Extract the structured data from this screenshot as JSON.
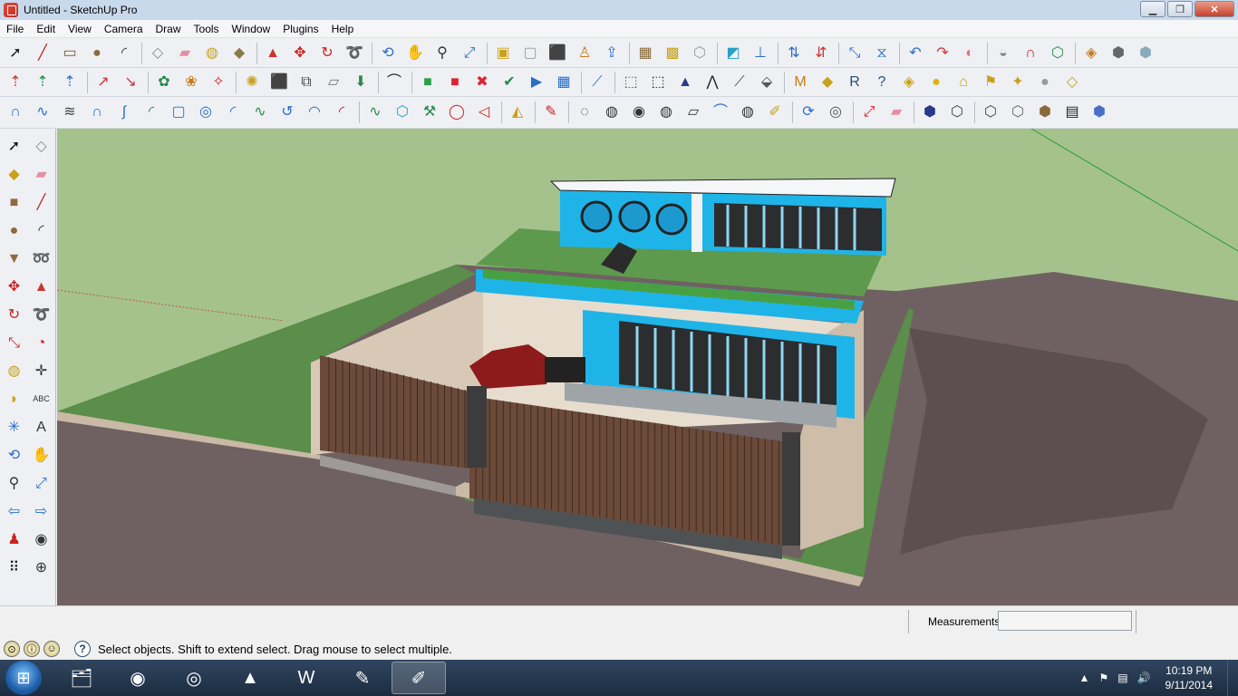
{
  "window": {
    "title": "Untitled - SketchUp Pro"
  },
  "menu": [
    "File",
    "Edit",
    "View",
    "Camera",
    "Draw",
    "Tools",
    "Window",
    "Plugins",
    "Help"
  ],
  "toolbars": {
    "row1": [
      {
        "name": "select-icon",
        "glyph": "➚",
        "color": "#222"
      },
      {
        "name": "line-icon",
        "glyph": "╱",
        "color": "#b22"
      },
      {
        "name": "rectangle-icon",
        "glyph": "▭",
        "color": "#7a5a30"
      },
      {
        "name": "circle-icon",
        "glyph": "●",
        "color": "#8d6a3f"
      },
      {
        "name": "arc-icon",
        "glyph": "◜",
        "color": "#333"
      },
      {
        "name": "sep"
      },
      {
        "name": "make-component-icon",
        "glyph": "◇",
        "color": "#888"
      },
      {
        "name": "eraser-icon",
        "glyph": "▰",
        "color": "#e58fa6"
      },
      {
        "name": "tape-measure-icon",
        "glyph": "◍",
        "color": "#c9a11a"
      },
      {
        "name": "paint-bucket-icon",
        "glyph": "◆",
        "color": "#8a7a4a"
      },
      {
        "name": "sep"
      },
      {
        "name": "push-pull-icon",
        "glyph": "▲",
        "color": "#c33"
      },
      {
        "name": "move-icon",
        "glyph": "✥",
        "color": "#c22"
      },
      {
        "name": "rotate-icon",
        "glyph": "↻",
        "color": "#c22"
      },
      {
        "name": "follow-me-icon",
        "glyph": "➰",
        "color": "#c22"
      },
      {
        "name": "sep"
      },
      {
        "name": "orbit-icon",
        "glyph": "⟲",
        "color": "#2a6ec7"
      },
      {
        "name": "pan-icon",
        "glyph": "✋",
        "color": "#555"
      },
      {
        "name": "zoom-icon",
        "glyph": "⚲",
        "color": "#333"
      },
      {
        "name": "zoom-extents-icon",
        "glyph": "⤢",
        "color": "#2a6ec7"
      },
      {
        "name": "sep"
      },
      {
        "name": "previous-view-icon",
        "glyph": "▣",
        "color": "#c9a11a"
      },
      {
        "name": "next-view-icon",
        "glyph": "▢",
        "color": "#999"
      },
      {
        "name": "get-models-icon",
        "glyph": "⬛",
        "color": "#8c4a2f"
      },
      {
        "name": "share-model-icon",
        "glyph": "♙",
        "color": "#c77a1a"
      },
      {
        "name": "upload-icon",
        "glyph": "⇪",
        "color": "#2a6ec7"
      },
      {
        "name": "sep"
      },
      {
        "name": "iso-view-icon",
        "glyph": "▦",
        "color": "#8a6a3a"
      },
      {
        "name": "top-view-icon",
        "glyph": "▩",
        "color": "#c9a11a"
      },
      {
        "name": "front-view-icon",
        "glyph": "⬡",
        "color": "#999"
      },
      {
        "name": "sep"
      },
      {
        "name": "section-plane-icon",
        "glyph": "◩",
        "color": "#2aa0c7"
      },
      {
        "name": "axes-icon",
        "glyph": "⊥",
        "color": "#2a6ec7"
      },
      {
        "name": "sep"
      },
      {
        "name": "dimension-icon",
        "glyph": "⇅",
        "color": "#2a6ec7"
      },
      {
        "name": "text-arrows-icon",
        "glyph": "⇵",
        "color": "#c33"
      },
      {
        "name": "sep"
      },
      {
        "name": "scale-icon",
        "glyph": "⤡",
        "color": "#2a6ec7"
      },
      {
        "name": "flip-icon",
        "glyph": "⧖",
        "color": "#2a6ec7"
      },
      {
        "name": "sep"
      },
      {
        "name": "undo-icon",
        "glyph": "↶",
        "color": "#2a6ec7"
      },
      {
        "name": "redo-icon",
        "glyph": "↷",
        "color": "#c33"
      },
      {
        "name": "sandbox-icon",
        "glyph": "◐",
        "color": "#d77"
      },
      {
        "name": "sep"
      },
      {
        "name": "shell-icon",
        "glyph": "◒",
        "color": "#888"
      },
      {
        "name": "magnet-icon",
        "glyph": "∩",
        "color": "#c22"
      },
      {
        "name": "component-options-icon",
        "glyph": "⬡",
        "color": "#2a8a4a"
      },
      {
        "name": "sep"
      },
      {
        "name": "warehouse-icon",
        "glyph": "◈",
        "color": "#c77a1a"
      },
      {
        "name": "wireframe-box-icon",
        "glyph": "⬢",
        "color": "#666"
      },
      {
        "name": "solid-box-icon",
        "glyph": "⬢",
        "color": "#8ab"
      }
    ],
    "row2": [
      {
        "name": "axis-j-icon",
        "glyph": "⇡",
        "color": "#c33"
      },
      {
        "name": "axis-v-icon",
        "glyph": "⇡",
        "color": "#2a8a4a"
      },
      {
        "name": "axis-n-icon",
        "glyph": "⇡",
        "color": "#2a6ec7"
      },
      {
        "name": "sep"
      },
      {
        "name": "arrow-up-icon",
        "glyph": "↗",
        "color": "#c33"
      },
      {
        "name": "arrow-right-icon",
        "glyph": "↘",
        "color": "#c33"
      },
      {
        "name": "sep"
      },
      {
        "name": "vegetation-icon",
        "glyph": "✿",
        "color": "#2a8a4a"
      },
      {
        "name": "palm-icon",
        "glyph": "❀",
        "color": "#c77a1a"
      },
      {
        "name": "spp-icon",
        "glyph": "✧",
        "color": "#c22"
      },
      {
        "name": "sep"
      },
      {
        "name": "bee-icon",
        "glyph": "✺",
        "color": "#c9a11a"
      },
      {
        "name": "cube-icon",
        "glyph": "⬛",
        "color": "#555"
      },
      {
        "name": "shapes-icon",
        "glyph": "⧉",
        "color": "#444"
      },
      {
        "name": "eraser-small-icon",
        "glyph": "▱",
        "color": "#777"
      },
      {
        "name": "svg-import-icon",
        "glyph": "⬇",
        "color": "#2a8a4a"
      },
      {
        "name": "sep"
      },
      {
        "name": "arc-tool-icon",
        "glyph": "⌒",
        "color": "#222"
      },
      {
        "name": "sep"
      },
      {
        "name": "film-green-icon",
        "glyph": "■",
        "color": "#2aa04a"
      },
      {
        "name": "film-red-icon",
        "glyph": "■",
        "color": "#d23"
      },
      {
        "name": "film-x-icon",
        "glyph": "✖",
        "color": "#d23"
      },
      {
        "name": "film-check-icon",
        "glyph": "✔",
        "color": "#2a8a4a"
      },
      {
        "name": "film-play-icon",
        "glyph": "▶",
        "color": "#2a6ec7"
      },
      {
        "name": "film-grid-icon",
        "glyph": "▦",
        "color": "#2a6ec7"
      },
      {
        "name": "sep"
      },
      {
        "name": "ruler-icon",
        "glyph": "⟋",
        "color": "#2a6ec7"
      },
      {
        "name": "sep"
      },
      {
        "name": "box-icon",
        "glyph": "⬚",
        "color": "#555"
      },
      {
        "name": "mesh-box-icon",
        "glyph": "⬚",
        "color": "#222"
      },
      {
        "name": "triangle-icon",
        "glyph": "▲",
        "color": "#2a3a8a"
      },
      {
        "name": "peak-icon",
        "glyph": "⋀",
        "color": "#222"
      },
      {
        "name": "pin-icon",
        "glyph": "⟋",
        "color": "#444"
      },
      {
        "name": "terrain-icon",
        "glyph": "⬙",
        "color": "#555"
      },
      {
        "name": "sep"
      },
      {
        "name": "m-badge-icon",
        "glyph": "M",
        "color": "#c77a1a"
      },
      {
        "name": "tag-icon",
        "glyph": "◆",
        "color": "#c9a11a"
      },
      {
        "name": "r-badge-icon",
        "glyph": "R",
        "color": "#2a4f7c"
      },
      {
        "name": "help-icon",
        "glyph": "?",
        "color": "#2a4f7c"
      },
      {
        "name": "label-icon",
        "glyph": "◈",
        "color": "#c9a11a"
      },
      {
        "name": "sun-icon",
        "glyph": "●",
        "color": "#e0b010"
      },
      {
        "name": "lamp-icon",
        "glyph": "⌂",
        "color": "#c9a11a"
      },
      {
        "name": "flag-icon",
        "glyph": "⚑",
        "color": "#c9a11a"
      },
      {
        "name": "spotlight-icon",
        "glyph": "✦",
        "color": "#c9a11a"
      },
      {
        "name": "sphere-icon",
        "glyph": "●",
        "color": "#999"
      },
      {
        "name": "plane-icon",
        "glyph": "◇",
        "color": "#c9a11a"
      }
    ],
    "row3": [
      {
        "name": "curve-1-icon",
        "glyph": "∩",
        "color": "#2a6ec7"
      },
      {
        "name": "curve-2-icon",
        "glyph": "∿",
        "color": "#2a6ec7"
      },
      {
        "name": "curve-3-icon",
        "glyph": "≋",
        "color": "#444"
      },
      {
        "name": "curve-4-icon",
        "glyph": "∩",
        "color": "#2a6ec7"
      },
      {
        "name": "curve-5-icon",
        "glyph": "∫",
        "color": "#2a6ec7"
      },
      {
        "name": "curve-6-icon",
        "glyph": "◜",
        "color": "#2a8a4a"
      },
      {
        "name": "curve-7-icon",
        "glyph": "▢",
        "color": "#2a6ec7"
      },
      {
        "name": "curve-8-icon",
        "glyph": "◎",
        "color": "#2a6ec7"
      },
      {
        "name": "curve-9-icon",
        "glyph": "◜",
        "color": "#2a6ec7"
      },
      {
        "name": "curve-10-icon",
        "glyph": "∿",
        "color": "#2a8a4a"
      },
      {
        "name": "curve-11-icon",
        "glyph": "↺",
        "color": "#2a6ec7"
      },
      {
        "name": "curve-12-icon",
        "glyph": "◠",
        "color": "#2a6ec7"
      },
      {
        "name": "curve-13-icon",
        "glyph": "◜",
        "color": "#c22"
      },
      {
        "name": "sep"
      },
      {
        "name": "curve-14-icon",
        "glyph": "∿",
        "color": "#2a8a4a"
      },
      {
        "name": "polygon-icon",
        "glyph": "⬡",
        "color": "#2aa0c7"
      },
      {
        "name": "wrench-icon",
        "glyph": "⚒",
        "color": "#2a8a4a"
      },
      {
        "name": "ellipse-icon",
        "glyph": "◯",
        "color": "#c22"
      },
      {
        "name": "spline-icon",
        "glyph": "◁",
        "color": "#c22"
      },
      {
        "name": "sep"
      },
      {
        "name": "surface-icon",
        "glyph": "◭",
        "color": "#c9a11a"
      },
      {
        "name": "sep"
      },
      {
        "name": "pencil-icon",
        "glyph": "✎",
        "color": "#c22"
      },
      {
        "name": "sep"
      },
      {
        "name": "loft-1-icon",
        "glyph": "◌",
        "color": "#333"
      },
      {
        "name": "loft-2-icon",
        "glyph": "◍",
        "color": "#333"
      },
      {
        "name": "loft-3-icon",
        "glyph": "◉",
        "color": "#333"
      },
      {
        "name": "loft-4-icon",
        "glyph": "◍",
        "color": "#333"
      },
      {
        "name": "loft-5-icon",
        "glyph": "▱",
        "color": "#333"
      },
      {
        "name": "loft-6-icon",
        "glyph": "⌒",
        "color": "#2a6ec7"
      },
      {
        "name": "loft-7-icon",
        "glyph": "◍",
        "color": "#333"
      },
      {
        "name": "loft-8-icon",
        "glyph": "✐",
        "color": "#c9a11a"
      },
      {
        "name": "sep"
      },
      {
        "name": "loop-icon",
        "glyph": "⟳",
        "color": "#2a6ec7"
      },
      {
        "name": "settings-ring-icon",
        "glyph": "◎",
        "color": "#555"
      },
      {
        "name": "sep"
      },
      {
        "name": "measure-arrow-icon",
        "glyph": "⤢",
        "color": "#c22"
      },
      {
        "name": "eraser-pink-icon",
        "glyph": "▰",
        "color": "#e58fa6"
      },
      {
        "name": "sep"
      },
      {
        "name": "style-shaded-icon",
        "glyph": "⬢",
        "color": "#2a3a8a"
      },
      {
        "name": "style-wire-icon",
        "glyph": "⬡",
        "color": "#444"
      },
      {
        "name": "sep"
      },
      {
        "name": "style-hidden-icon",
        "glyph": "⬡",
        "color": "#444"
      },
      {
        "name": "style-mono-icon",
        "glyph": "⬡",
        "color": "#666"
      },
      {
        "name": "style-texture-icon",
        "glyph": "⬢",
        "color": "#8a6a3a"
      },
      {
        "name": "style-xray-icon",
        "glyph": "▤",
        "color": "#222"
      },
      {
        "name": "style-blue-icon",
        "glyph": "⬢",
        "color": "#4a6ec7"
      }
    ]
  },
  "left_toolbar": [
    {
      "name": "select-tool-icon",
      "glyph": "➚",
      "color": "#111"
    },
    {
      "name": "component-tool-icon",
      "glyph": "◇",
      "color": "#888"
    },
    {
      "name": "paint-tool-icon",
      "glyph": "◆",
      "color": "#c9a11a"
    },
    {
      "name": "eraser-tool-icon",
      "glyph": "▰",
      "color": "#e58fa6"
    },
    {
      "name": "rectangle-tool-icon",
      "glyph": "■",
      "color": "#8d6a3f"
    },
    {
      "name": "line-tool-icon",
      "glyph": "╱",
      "color": "#b22"
    },
    {
      "name": "circle-tool-icon",
      "glyph": "●",
      "color": "#8d6a3f"
    },
    {
      "name": "arc-tool-left-icon",
      "glyph": "◜",
      "color": "#333"
    },
    {
      "name": "polygon-tool-icon",
      "glyph": "▼",
      "color": "#8d6a3f"
    },
    {
      "name": "freehand-tool-icon",
      "glyph": "➿",
      "color": "#333"
    },
    {
      "name": "move-tool-icon",
      "glyph": "✥",
      "color": "#c22"
    },
    {
      "name": "push-pull-tool-icon",
      "glyph": "▲",
      "color": "#c33"
    },
    {
      "name": "rotate-tool-icon",
      "glyph": "↻",
      "color": "#c22"
    },
    {
      "name": "follow-me-tool-icon",
      "glyph": "➰",
      "color": "#c22"
    },
    {
      "name": "scale-tool-icon",
      "glyph": "⤡",
      "color": "#c22"
    },
    {
      "name": "offset-tool-icon",
      "glyph": "◔",
      "color": "#c22"
    },
    {
      "name": "tape-tool-icon",
      "glyph": "◍",
      "color": "#c9a11a"
    },
    {
      "name": "dimension-tool-icon",
      "glyph": "✛",
      "color": "#333"
    },
    {
      "name": "protractor-tool-icon",
      "glyph": "◗",
      "color": "#c9a11a"
    },
    {
      "name": "text-tool-icon",
      "glyph": "ABC",
      "color": "#333"
    },
    {
      "name": "axes-tool-icon",
      "glyph": "✳",
      "color": "#2a6ec7"
    },
    {
      "name": "3d-text-tool-icon",
      "glyph": "A",
      "color": "#333"
    },
    {
      "name": "orbit-tool-icon",
      "glyph": "⟲",
      "color": "#2a6ec7"
    },
    {
      "name": "pan-tool-icon",
      "glyph": "✋",
      "color": "#555"
    },
    {
      "name": "zoom-tool-icon",
      "glyph": "⚲",
      "color": "#333"
    },
    {
      "name": "zoom-window-tool-icon",
      "glyph": "⤢",
      "color": "#2a6ec7"
    },
    {
      "name": "previous-tool-icon",
      "glyph": "⇦",
      "color": "#2a6ec7"
    },
    {
      "name": "next-tool-icon",
      "glyph": "⇨",
      "color": "#2a6ec7"
    },
    {
      "name": "walk-tool-icon",
      "glyph": "♟",
      "color": "#c22"
    },
    {
      "name": "look-around-tool-icon",
      "glyph": "◉",
      "color": "#333"
    },
    {
      "name": "footprints-tool-icon",
      "glyph": "⠿",
      "color": "#222"
    },
    {
      "name": "section-tool-icon",
      "glyph": "⊕",
      "color": "#333"
    }
  ],
  "measurements": {
    "label": "Measurements",
    "value": ""
  },
  "status": {
    "text": "Select objects. Shift to extend select. Drag mouse to select multiple."
  },
  "taskbar": {
    "apps": [
      {
        "name": "explorer-app-icon",
        "glyph": "🗂",
        "active": false
      },
      {
        "name": "firefox-app-icon",
        "glyph": "◉",
        "active": false
      },
      {
        "name": "chrome-app-icon",
        "glyph": "◎",
        "active": false
      },
      {
        "name": "autocad-app-icon",
        "glyph": "▲",
        "active": false
      },
      {
        "name": "word-app-icon",
        "glyph": "W",
        "active": false
      },
      {
        "name": "paint-app-icon",
        "glyph": "✎",
        "active": false
      },
      {
        "name": "sketchup-app-icon",
        "glyph": "✐",
        "active": true
      }
    ],
    "time": "10:19 PM",
    "date": "9/11/2014"
  },
  "colors": {
    "viewport_sky": "#a5c28d",
    "ground": "#6f6161",
    "grass": "#5a8e4a",
    "accent_cyan": "#1fb4e8",
    "fence": "#6b4a3a",
    "wall": "#d8c9b7"
  }
}
